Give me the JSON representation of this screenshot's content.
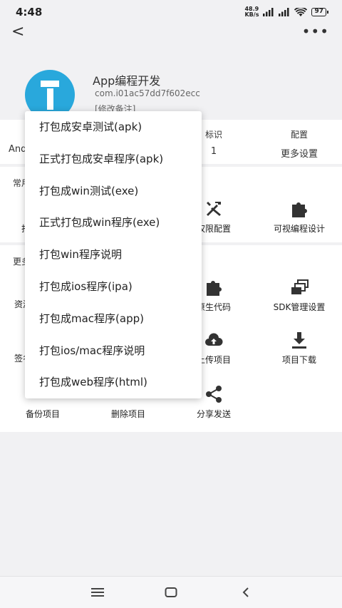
{
  "status": {
    "time": "4:48",
    "speed_top": "48.9",
    "speed_bottom": "KB/s",
    "battery": "97"
  },
  "header": {
    "back": "<",
    "more": "•••"
  },
  "app": {
    "name": "App编程开发",
    "id": "com.i01ac57dd7f602ecc",
    "note": "[修改备注]"
  },
  "info": [
    {
      "label": "",
      "value": "And"
    },
    {
      "label": "标识",
      "value": "1"
    },
    {
      "label": "配置",
      "value": "更多设置"
    }
  ],
  "sections": {
    "common": "常用",
    "more": "更多"
  },
  "common_tools": [
    {
      "label": "打",
      "icon": "build-icon"
    },
    {
      "label": "权限配置",
      "icon": "tools-icon"
    },
    {
      "label": "可视编程设计",
      "icon": "puzzle-icon"
    }
  ],
  "more_tools": [
    {
      "label": "资源",
      "icon": "resource-icon"
    },
    {
      "label": "原生代码",
      "icon": "puzzle-icon"
    },
    {
      "label": "SDK管理设置",
      "icon": "sdk-icon"
    },
    {
      "label": "签名",
      "icon": "sign-icon"
    },
    {
      "label": "上传项目",
      "icon": "cloud-upload-icon"
    },
    {
      "label": "项目下载",
      "icon": "download-icon"
    },
    {
      "label": "备份项目",
      "icon": "backup-icon"
    },
    {
      "label": "删除项目",
      "icon": "delete-icon"
    },
    {
      "label": "分享发送",
      "icon": "share-icon"
    }
  ],
  "menu": [
    "打包成安卓测试(apk)",
    "正式打包成安卓程序(apk)",
    "打包成win测试(exe)",
    "正式打包成win程序(exe)",
    "打包win程序说明",
    "打包成ios程序(ipa)",
    "打包成mac程序(app)",
    "打包ios/mac程序说明",
    "打包成web程序(html)"
  ],
  "colors": {
    "logo": "#29a8dc",
    "background": "#f1f1f3"
  }
}
